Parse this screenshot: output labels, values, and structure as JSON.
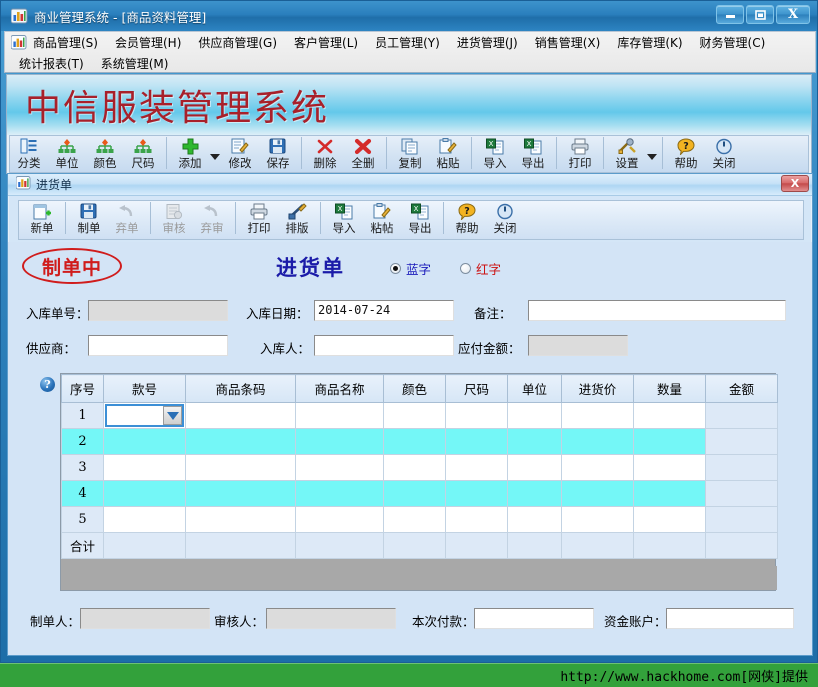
{
  "main_window": {
    "title": "商业管理系统 - [商品资料管理]",
    "icon": "chart-bars-icon",
    "buttons": {
      "minimize": "—",
      "maximize": "❐",
      "close": "X"
    }
  },
  "menubar": {
    "icon": "chart-bars-icon",
    "row1": [
      "商品管理(S)",
      "会员管理(H)",
      "供应商管理(G)",
      "客户管理(L)",
      "员工管理(Y)",
      "进货管理(J)",
      "销售管理(X)",
      "库存管理(K)",
      "财务管理(C)"
    ],
    "row2": [
      "统计报表(T)",
      "系统管理(M)"
    ],
    "mdi_controls": {
      "minimize": "_",
      "restore": "❐",
      "close": "✕"
    }
  },
  "background_child": {
    "banner_title": "中信服装管理系统",
    "toolbar": [
      {
        "label": "分类",
        "icon": "category-list-icon",
        "disabled": false,
        "caret": false
      },
      {
        "label": "单位",
        "icon": "unit-tree-icon",
        "disabled": false,
        "caret": false
      },
      {
        "label": "颜色",
        "icon": "color-tree-icon",
        "disabled": false,
        "caret": false
      },
      {
        "label": "尺码",
        "icon": "size-tree-icon",
        "disabled": false,
        "caret": false
      },
      {
        "label": "添加",
        "icon": "plus-green-icon",
        "disabled": false,
        "caret": true
      },
      {
        "label": "修改",
        "icon": "edit-pencil-icon",
        "disabled": false,
        "caret": false
      },
      {
        "label": "保存",
        "icon": "save-disk-icon",
        "disabled": false,
        "caret": false
      },
      {
        "label": "删除",
        "icon": "delete-x-icon",
        "disabled": false,
        "caret": false
      },
      {
        "label": "全删",
        "icon": "delete-all-x-icon",
        "disabled": false,
        "caret": false
      },
      {
        "label": "复制",
        "icon": "copy-icon",
        "disabled": false,
        "caret": false
      },
      {
        "label": "粘贴",
        "icon": "paste-icon",
        "disabled": false,
        "caret": false
      },
      {
        "label": "导入",
        "icon": "excel-import-icon",
        "disabled": false,
        "caret": false
      },
      {
        "label": "导出",
        "icon": "excel-export-icon",
        "disabled": false,
        "caret": false
      },
      {
        "label": "打印",
        "icon": "printer-icon",
        "disabled": false,
        "caret": false
      },
      {
        "label": "设置",
        "icon": "tools-icon",
        "disabled": false,
        "caret": true
      },
      {
        "label": "帮助",
        "icon": "help-question-icon",
        "disabled": false,
        "caret": false
      },
      {
        "label": "关闭",
        "icon": "power-close-icon",
        "disabled": false,
        "caret": false
      }
    ]
  },
  "invoice_window": {
    "title": "进货单",
    "icon": "chart-bars-icon",
    "close_label": "X",
    "toolbar": [
      {
        "label": "新单",
        "icon": "new-doc-icon",
        "disabled": false
      },
      {
        "label": "制单",
        "icon": "save-disk-icon",
        "disabled": false
      },
      {
        "label": "弃单",
        "icon": "undo-arrow-icon",
        "disabled": true
      },
      {
        "label": "审核",
        "icon": "audit-doc-icon",
        "disabled": true
      },
      {
        "label": "弃审",
        "icon": "undo-arrow-icon",
        "disabled": true
      },
      {
        "label": "打印",
        "icon": "printer-icon",
        "disabled": false
      },
      {
        "label": "排版",
        "icon": "layout-ruler-icon",
        "disabled": false
      },
      {
        "label": "导入",
        "icon": "excel-import-icon",
        "disabled": false
      },
      {
        "label": "粘帖",
        "icon": "paste-icon",
        "disabled": false
      },
      {
        "label": "导出",
        "icon": "excel-export-icon",
        "disabled": false
      },
      {
        "label": "帮助",
        "icon": "help-question-icon",
        "disabled": false
      },
      {
        "label": "关闭",
        "icon": "power-close-icon",
        "disabled": false
      }
    ],
    "stamp": "制单中",
    "doc_title": "进货单",
    "type_options": [
      {
        "label": "蓝字",
        "selected": true,
        "color": "#1b1bbb"
      },
      {
        "label": "红字",
        "selected": false,
        "color": "#cc1111"
      }
    ],
    "fields": {
      "order_no": {
        "label": "入库单号：",
        "value": "",
        "readonly": true
      },
      "in_date": {
        "label": "入库日期：",
        "value": "2014-07-24",
        "readonly": false
      },
      "remark": {
        "label": "备注：",
        "value": "",
        "readonly": false
      },
      "supplier": {
        "label": "供应商：",
        "value": "",
        "readonly": false
      },
      "receiver": {
        "label": "入库人：",
        "value": "",
        "readonly": false
      },
      "payable": {
        "label": "应付金额：",
        "value": "",
        "readonly": true
      },
      "maker": {
        "label": "制单人：",
        "value": "",
        "readonly": true
      },
      "auditor": {
        "label": "审核人：",
        "value": "",
        "readonly": true
      },
      "payment": {
        "label": "本次付款：",
        "value": "",
        "readonly": false
      },
      "account": {
        "label": "资金账户：",
        "value": "",
        "readonly": false
      }
    },
    "grid": {
      "help_icon": "?",
      "columns": [
        "序号",
        "款号",
        "商品条码",
        "商品名称",
        "颜色",
        "尺码",
        "单位",
        "进货价",
        "数量",
        "金额"
      ],
      "rows": [
        {
          "idx": "1",
          "cells": [
            "",
            "",
            "",
            "",
            "",
            "",
            "",
            "",
            ""
          ],
          "alt": false,
          "selected_col": 1
        },
        {
          "idx": "2",
          "cells": [
            "",
            "",
            "",
            "",
            "",
            "",
            "",
            "",
            ""
          ],
          "alt": true
        },
        {
          "idx": "3",
          "cells": [
            "",
            "",
            "",
            "",
            "",
            "",
            "",
            "",
            ""
          ],
          "alt": false
        },
        {
          "idx": "4",
          "cells": [
            "",
            "",
            "",
            "",
            "",
            "",
            "",
            "",
            ""
          ],
          "alt": true
        },
        {
          "idx": "5",
          "cells": [
            "",
            "",
            "",
            "",
            "",
            "",
            "",
            "",
            ""
          ],
          "alt": false
        }
      ],
      "total_row": {
        "idx": "合计",
        "cells": [
          "",
          "",
          "",
          "",
          "",
          "",
          "",
          "",
          ""
        ]
      },
      "dropdown_icon": "chevron-down-icon"
    }
  },
  "statusbar": {
    "url": "http://www.hackhome.com[网侠]提供"
  },
  "colors": {
    "titlebar": "#2a7fbd",
    "form_bg": "#d3e4f6",
    "alt_row": "#74f7f7",
    "header": "#d6e6f6",
    "status_green": "#33a13b",
    "stamp_red": "#d01c1c",
    "doc_blue": "#1b1ba8",
    "banner_red": "#a8202a"
  }
}
